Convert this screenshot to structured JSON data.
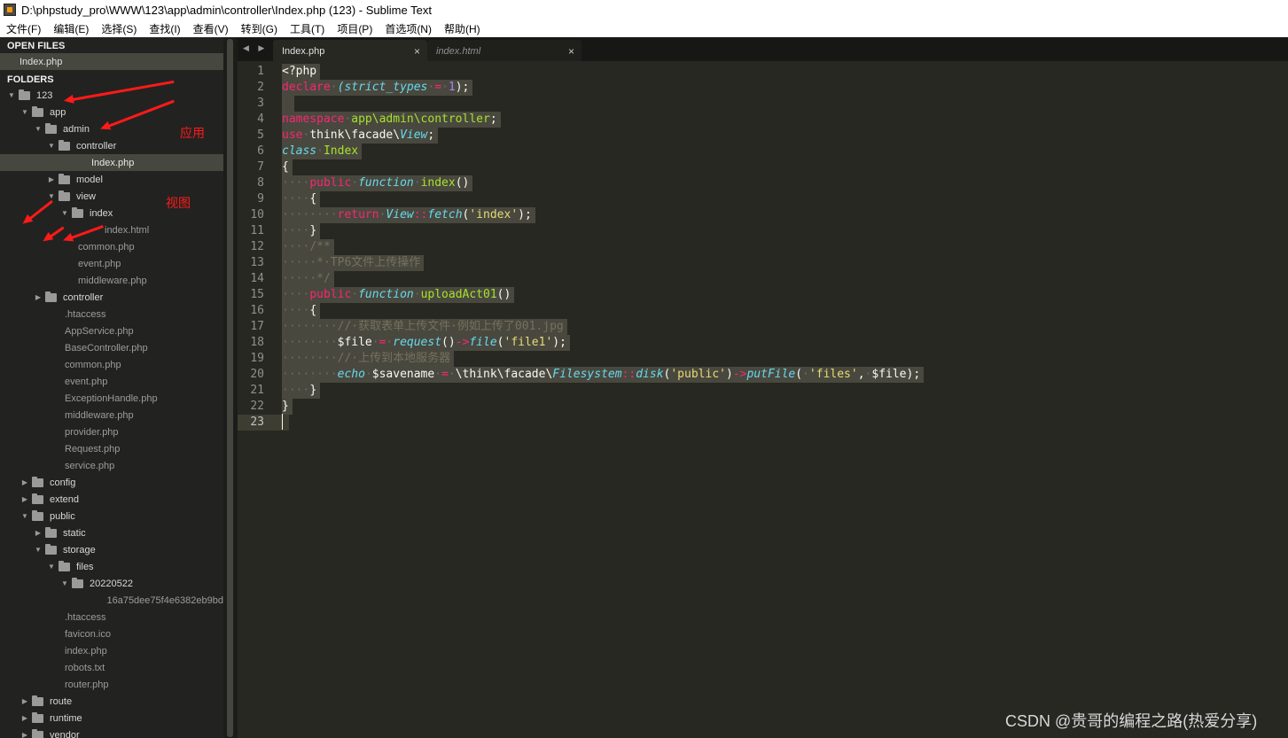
{
  "window": {
    "title": "D:\\phpstudy_pro\\WWW\\123\\app\\admin\\controller\\Index.php (123) - Sublime Text"
  },
  "menu": [
    "文件(F)",
    "编辑(E)",
    "选择(S)",
    "查找(I)",
    "查看(V)",
    "转到(G)",
    "工具(T)",
    "项目(P)",
    "首选项(N)",
    "帮助(H)"
  ],
  "sidebar": {
    "open_files_title": "OPEN FILES",
    "open_files": [
      "Index.php"
    ],
    "folders_title": "FOLDERS",
    "tree": [
      {
        "label": "123",
        "type": "dir",
        "open": true,
        "depth": 0
      },
      {
        "label": "app",
        "type": "dir",
        "open": true,
        "depth": 1
      },
      {
        "label": "admin",
        "type": "dir",
        "open": true,
        "depth": 2
      },
      {
        "label": "controller",
        "type": "dir",
        "open": true,
        "depth": 3
      },
      {
        "label": "Index.php",
        "type": "file",
        "depth": 4,
        "selected": true
      },
      {
        "label": "model",
        "type": "dir",
        "open": false,
        "depth": 3
      },
      {
        "label": "view",
        "type": "dir",
        "open": true,
        "depth": 3
      },
      {
        "label": "index",
        "type": "dir",
        "open": true,
        "depth": 4
      },
      {
        "label": "index.html",
        "type": "file",
        "depth": 5
      },
      {
        "label": "common.php",
        "type": "file",
        "depth": 3
      },
      {
        "label": "event.php",
        "type": "file",
        "depth": 3
      },
      {
        "label": "middleware.php",
        "type": "file",
        "depth": 3
      },
      {
        "label": "controller",
        "type": "dir",
        "open": false,
        "depth": 2
      },
      {
        "label": ".htaccess",
        "type": "file",
        "depth": 2
      },
      {
        "label": "AppService.php",
        "type": "file",
        "depth": 2
      },
      {
        "label": "BaseController.php",
        "type": "file",
        "depth": 2
      },
      {
        "label": "common.php",
        "type": "file",
        "depth": 2
      },
      {
        "label": "event.php",
        "type": "file",
        "depth": 2
      },
      {
        "label": "ExceptionHandle.php",
        "type": "file",
        "depth": 2
      },
      {
        "label": "middleware.php",
        "type": "file",
        "depth": 2
      },
      {
        "label": "provider.php",
        "type": "file",
        "depth": 2
      },
      {
        "label": "Request.php",
        "type": "file",
        "depth": 2
      },
      {
        "label": "service.php",
        "type": "file",
        "depth": 2
      },
      {
        "label": "config",
        "type": "dir",
        "open": false,
        "depth": 1
      },
      {
        "label": "extend",
        "type": "dir",
        "open": false,
        "depth": 1
      },
      {
        "label": "public",
        "type": "dir",
        "open": true,
        "depth": 1
      },
      {
        "label": "static",
        "type": "dir",
        "open": false,
        "depth": 2
      },
      {
        "label": "storage",
        "type": "dir",
        "open": true,
        "depth": 2
      },
      {
        "label": "files",
        "type": "dir",
        "open": true,
        "depth": 3
      },
      {
        "label": "20220522",
        "type": "dir",
        "open": true,
        "depth": 4
      },
      {
        "label": "16a75dee75f4e6382eb9bd",
        "type": "file",
        "depth": 6
      },
      {
        "label": ".htaccess",
        "type": "file",
        "depth": 2
      },
      {
        "label": "favicon.ico",
        "type": "file",
        "depth": 2
      },
      {
        "label": "index.php",
        "type": "file",
        "depth": 2
      },
      {
        "label": "robots.txt",
        "type": "file",
        "depth": 2
      },
      {
        "label": "router.php",
        "type": "file",
        "depth": 2
      },
      {
        "label": "route",
        "type": "dir",
        "open": false,
        "depth": 1
      },
      {
        "label": "runtime",
        "type": "dir",
        "open": false,
        "depth": 1
      },
      {
        "label": "vendor",
        "type": "dir",
        "open": false,
        "depth": 1
      }
    ]
  },
  "tabs": [
    {
      "label": "Index.php",
      "active": true
    },
    {
      "label": "index.html",
      "active": false
    }
  ],
  "tab_close_glyph": "×",
  "annotations": {
    "app_label": "应用",
    "view_label": "视图"
  },
  "editor": {
    "current_line": 23,
    "lines": [
      [
        [
          "<?php",
          ""
        ]
      ],
      [
        [
          "declare",
          "kw"
        ],
        [
          "·",
          "ws"
        ],
        [
          "(strict_types",
          "st"
        ],
        [
          "·",
          "ws"
        ],
        [
          "=",
          "kw"
        ],
        [
          "·",
          "ws"
        ],
        [
          "1",
          "num"
        ],
        [
          ");",
          ""
        ]
      ],
      [],
      [
        [
          "namespace",
          "kw"
        ],
        [
          "·",
          "ws"
        ],
        [
          "app\\admin\\controller",
          "fn"
        ],
        [
          ";",
          ""
        ]
      ],
      [
        [
          "use",
          "kw"
        ],
        [
          "·",
          "ws"
        ],
        [
          "think\\facade\\",
          ""
        ],
        [
          "View",
          "st"
        ],
        [
          ";",
          ""
        ]
      ],
      [
        [
          "class",
          "st"
        ],
        [
          "·",
          "ws"
        ],
        [
          "Index",
          "fn"
        ]
      ],
      [
        [
          "{",
          ""
        ]
      ],
      [
        [
          "····",
          "ws"
        ],
        [
          "public",
          "kw"
        ],
        [
          "·",
          "ws"
        ],
        [
          "function",
          "st"
        ],
        [
          "·",
          "ws"
        ],
        [
          "index",
          "fn"
        ],
        [
          "()",
          ""
        ]
      ],
      [
        [
          "····",
          "ws"
        ],
        [
          "{",
          ""
        ]
      ],
      [
        [
          "········",
          "ws"
        ],
        [
          "return",
          "kw"
        ],
        [
          "·",
          "ws"
        ],
        [
          "View",
          "st"
        ],
        [
          "::",
          "kw"
        ],
        [
          "fetch",
          "st"
        ],
        [
          "(",
          ""
        ],
        [
          "'index'",
          "str"
        ],
        [
          ");",
          ""
        ]
      ],
      [
        [
          "····",
          "ws"
        ],
        [
          "}",
          ""
        ]
      ],
      [
        [
          "····",
          "ws"
        ],
        [
          "/**",
          "cm"
        ]
      ],
      [
        [
          "····",
          "ws"
        ],
        [
          "·*·TP6文件上传操作",
          "cm"
        ]
      ],
      [
        [
          "····",
          "ws"
        ],
        [
          "·*/",
          "cm"
        ]
      ],
      [
        [
          "····",
          "ws"
        ],
        [
          "public",
          "kw"
        ],
        [
          "·",
          "ws"
        ],
        [
          "function",
          "st"
        ],
        [
          "·",
          "ws"
        ],
        [
          "uploadAct01",
          "fn"
        ],
        [
          "()",
          ""
        ]
      ],
      [
        [
          "····",
          "ws"
        ],
        [
          "{",
          ""
        ]
      ],
      [
        [
          "········",
          "ws"
        ],
        [
          "//·获取表单上传文件·例如上传了001.jpg",
          "cm"
        ]
      ],
      [
        [
          "········",
          "ws"
        ],
        [
          "$file",
          ""
        ],
        [
          "·",
          "ws"
        ],
        [
          "=",
          "kw"
        ],
        [
          "·",
          "ws"
        ],
        [
          "request",
          "st"
        ],
        [
          "()",
          ""
        ],
        [
          "->",
          "kw"
        ],
        [
          "file",
          "st"
        ],
        [
          "(",
          ""
        ],
        [
          "'file1'",
          "str"
        ],
        [
          ");",
          ""
        ]
      ],
      [
        [
          "········",
          "ws"
        ],
        [
          "//·上传到本地服务器",
          "cm"
        ]
      ],
      [
        [
          "········",
          "ws"
        ],
        [
          "echo",
          "st"
        ],
        [
          "·",
          "ws"
        ],
        [
          "$savename",
          ""
        ],
        [
          "·",
          "ws"
        ],
        [
          "=",
          "kw"
        ],
        [
          "·",
          "ws"
        ],
        [
          "\\think\\facade\\",
          ""
        ],
        [
          "Filesystem",
          "st"
        ],
        [
          "::",
          "kw"
        ],
        [
          "disk",
          "st"
        ],
        [
          "(",
          ""
        ],
        [
          "'public'",
          "str"
        ],
        [
          ")",
          ""
        ],
        [
          "->",
          "kw"
        ],
        [
          "putFile",
          "st"
        ],
        [
          "(",
          ""
        ],
        [
          "·",
          "ws"
        ],
        [
          "'files'",
          "str"
        ],
        [
          ",",
          ""
        ],
        [
          "·",
          "ws"
        ],
        [
          "$file",
          ""
        ],
        [
          ");",
          ""
        ]
      ],
      [
        [
          "····",
          "ws"
        ],
        [
          "}",
          ""
        ]
      ],
      [
        [
          "}",
          ""
        ]
      ],
      []
    ]
  },
  "watermark": "CSDN @贵哥的编程之路(热爱分享)"
}
